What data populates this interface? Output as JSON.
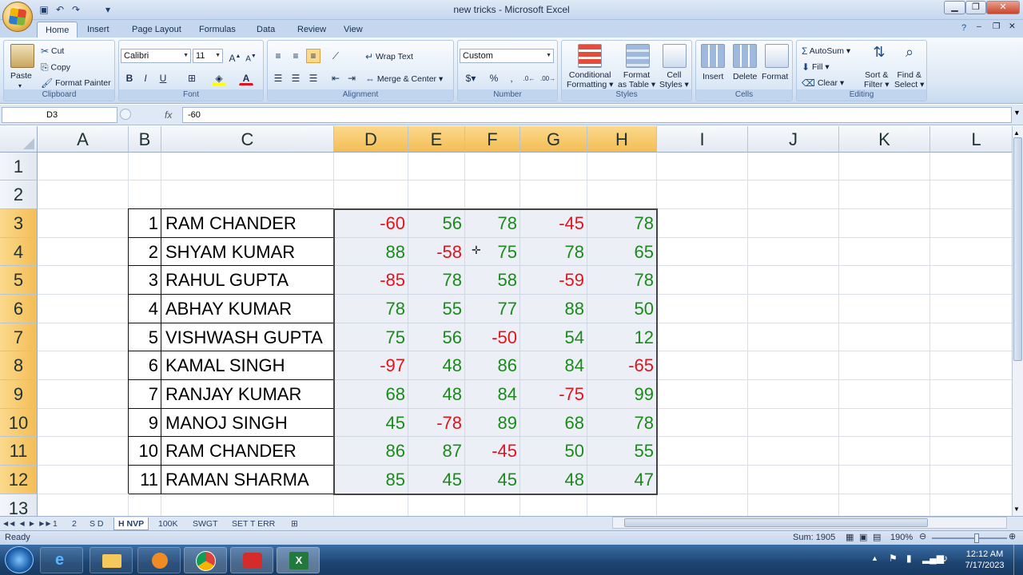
{
  "window": {
    "title": "new tricks - Microsoft Excel",
    "minimize_icon": "minimize-icon",
    "maximize_icon": "restore-icon",
    "close_icon": "close-icon"
  },
  "ribbon_tabs": [
    "Home",
    "Insert",
    "Page Layout",
    "Formulas",
    "Data",
    "Review",
    "View"
  ],
  "active_tab": "Home",
  "clipboard": {
    "paste": "Paste",
    "cut": "Cut",
    "copy": "Copy",
    "format_painter": "Format Painter",
    "label": "Clipboard"
  },
  "font": {
    "name": "Calibri",
    "size": "11",
    "bold": "B",
    "italic": "I",
    "underline": "U",
    "label": "Font"
  },
  "alignment": {
    "wrap_text": "Wrap Text",
    "merge_center": "Merge & Center",
    "label": "Alignment"
  },
  "number": {
    "format": "Custom",
    "currency": "$",
    "percent": "%",
    "comma": ",",
    "label": "Number"
  },
  "styles": {
    "conditional": "Conditional",
    "formatting": "Formatting",
    "format_as": "Format",
    "as_table": "as Table",
    "cell": "Cell",
    "cell_styles": "Styles",
    "label": "Styles"
  },
  "cells": {
    "insert": "Insert",
    "delete": "Delete",
    "format": "Format",
    "label": "Cells"
  },
  "editing": {
    "autosum": "AutoSum",
    "fill": "Fill",
    "clear": "Clear",
    "sort": "Sort &",
    "filter": "Filter",
    "find": "Find &",
    "select": "Select",
    "label": "Editing"
  },
  "formula_bar": {
    "name_box": "D3",
    "fx": "fx",
    "formula": "-60"
  },
  "columns": [
    "A",
    "B",
    "C",
    "D",
    "E",
    "F",
    "G",
    "H",
    "I",
    "J",
    "K",
    "L"
  ],
  "rows": [
    "1",
    "2",
    "3",
    "4",
    "5",
    "6",
    "7",
    "8",
    "9",
    "10",
    "11",
    "12",
    "13"
  ],
  "table": [
    {
      "num": "1",
      "name": "RAM CHANDER",
      "values": [
        "-60",
        "56",
        "78",
        "-45",
        "78"
      ]
    },
    {
      "num": "2",
      "name": "SHYAM KUMAR",
      "values": [
        "88",
        "-58",
        "75",
        "78",
        "65"
      ]
    },
    {
      "num": "3",
      "name": "RAHUL GUPTA",
      "values": [
        "-85",
        "78",
        "58",
        "-59",
        "78"
      ]
    },
    {
      "num": "4",
      "name": "ABHAY KUMAR",
      "values": [
        "78",
        "55",
        "77",
        "88",
        "50"
      ]
    },
    {
      "num": "5",
      "name": "VISHWASH GUPTA",
      "values": [
        "75",
        "56",
        "-50",
        "54",
        "12"
      ]
    },
    {
      "num": "6",
      "name": "KAMAL SINGH",
      "values": [
        "-97",
        "48",
        "86",
        "84",
        "-65"
      ]
    },
    {
      "num": "7",
      "name": "RANJAY KUMAR",
      "values": [
        "68",
        "48",
        "84",
        "-75",
        "99"
      ]
    },
    {
      "num": "9",
      "name": "MANOJ SINGH",
      "values": [
        "45",
        "-78",
        "89",
        "68",
        "78"
      ]
    },
    {
      "num": "10",
      "name": "RAM CHANDER",
      "values": [
        "86",
        "87",
        "-45",
        "50",
        "55"
      ]
    },
    {
      "num": "11",
      "name": "RAMAN SHARMA",
      "values": [
        "85",
        "45",
        "45",
        "48",
        "47"
      ]
    }
  ],
  "sheet_tabs": [
    "1",
    "2",
    "S D",
    "H NVP",
    "100K",
    "SWGT",
    "SET T ERR"
  ],
  "active_sheet": "H NVP",
  "status": {
    "ready": "Ready",
    "sum": "Sum: 1905",
    "zoom": "190%"
  },
  "taskbar": {
    "time": "12:12 AM",
    "date": "7/17/2023"
  },
  "colors": {
    "positive": "#1a8a1a",
    "negative": "#e0141c",
    "selection_header": "#f3bd55"
  }
}
